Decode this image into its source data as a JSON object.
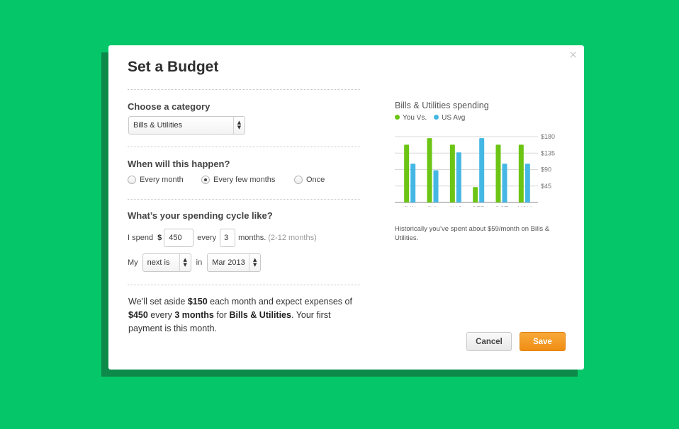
{
  "modal": {
    "title": "Set a Budget",
    "close_glyph": "×"
  },
  "category": {
    "label": "Choose a category",
    "selected": "Bills & Utilities"
  },
  "frequency": {
    "label": "When will this happen?",
    "options": [
      "Every month",
      "Every few months",
      "Once"
    ],
    "selected": "Every few months"
  },
  "cycle": {
    "label": "What’s your spending cycle like?",
    "spend_prefix": "I spend",
    "currency": "$",
    "amount": "450",
    "every_word": "every",
    "months_value": "3",
    "months_word": "months.",
    "months_hint": "(2-12 months)",
    "my_word": "My",
    "next_select": "next is",
    "in_word": "in",
    "month_select": "Mar 2013"
  },
  "summary": {
    "t1": "We’ll set aside ",
    "b1": "$150",
    "t2": " each month and expect expenses of ",
    "b2": "$450",
    "t3": " every ",
    "b3": "3 months",
    "t4": " for ",
    "b4": "Bills & Utilities",
    "t5": ". Your first payment is this month."
  },
  "chart_data": {
    "type": "bar",
    "title": "Bills & Utilities spending",
    "categories": [
      "JUN",
      "JUL",
      "AUG",
      "SEP",
      "OCT",
      "NOV"
    ],
    "series": [
      {
        "name": "You Vs.",
        "color": "#6cc414",
        "values": [
          158,
          176,
          158,
          42,
          158,
          158
        ]
      },
      {
        "name": "US Avg",
        "color": "#45b7e4",
        "values": [
          106,
          88,
          137,
          176,
          106,
          106
        ]
      }
    ],
    "y_ticks": [
      45,
      90,
      135,
      180
    ],
    "y_tick_labels": [
      "$45",
      "$90",
      "$135",
      "$180"
    ],
    "ylim": [
      0,
      180
    ],
    "grid": true
  },
  "chart_note": "Historically you’ve spent about $59/month on Bills & Utilities.",
  "buttons": {
    "cancel": "Cancel",
    "save": "Save"
  }
}
